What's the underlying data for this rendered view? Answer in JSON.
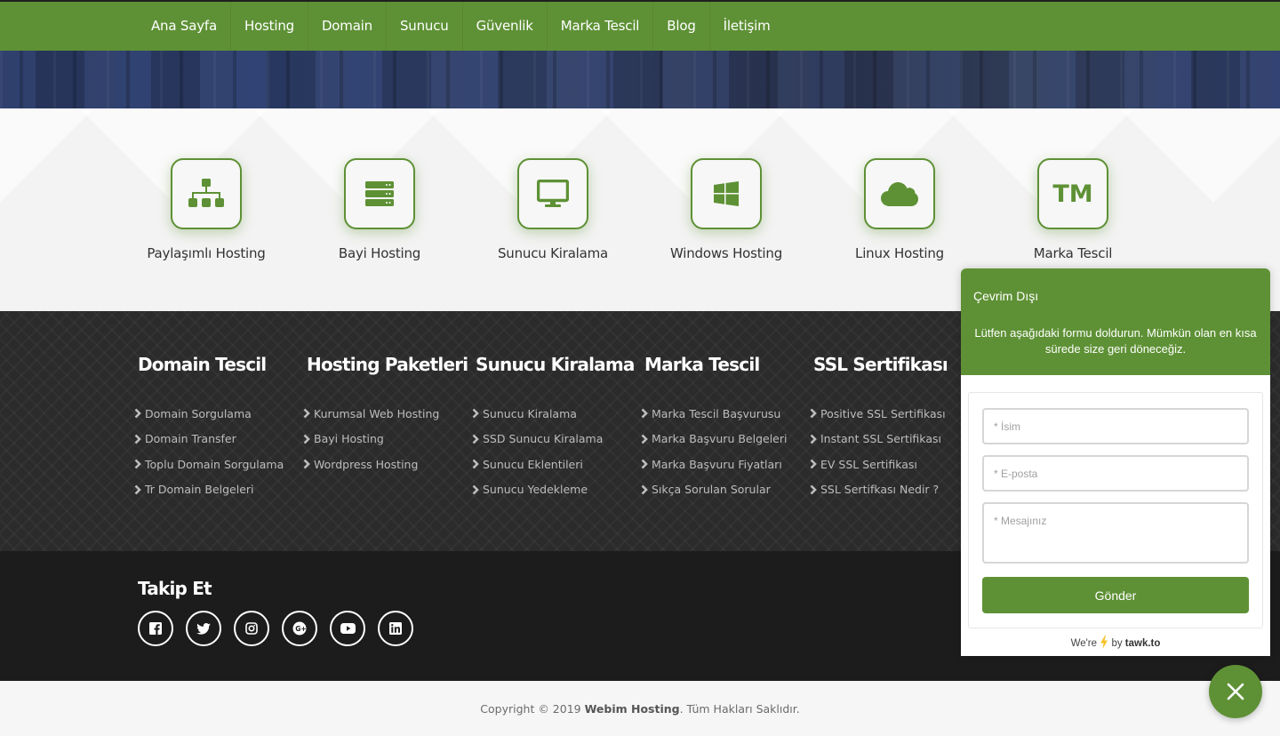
{
  "nav": {
    "items": [
      {
        "label": "Ana Sayfa"
      },
      {
        "label": "Hosting"
      },
      {
        "label": "Domain"
      },
      {
        "label": "Sunucu"
      },
      {
        "label": "Güvenlik"
      },
      {
        "label": "Marka Tescil"
      },
      {
        "label": "Blog"
      },
      {
        "label": "İletişim"
      }
    ]
  },
  "colors": {
    "brand_green": "#5e9135",
    "footer_dark": "#2b2b2b",
    "social_bg": "#1c1c1c"
  },
  "services": [
    {
      "label": "Paylaşımlı Hosting",
      "icon": "sitemap-icon"
    },
    {
      "label": "Bayi Hosting",
      "icon": "server-icon"
    },
    {
      "label": "Sunucu Kiralama",
      "icon": "desktop-icon"
    },
    {
      "label": "Windows Hosting",
      "icon": "windows-icon"
    },
    {
      "label": "Linux Hosting",
      "icon": "cloud-icon"
    },
    {
      "label": "Marka Tescil",
      "icon": "trademark-icon",
      "glyph": "TM"
    }
  ],
  "footer_columns": [
    {
      "title": "Domain Tescil",
      "links": [
        "Domain Sorgulama",
        "Domain Transfer",
        "Toplu Domain Sorgulama",
        "Tr Domain Belgeleri"
      ]
    },
    {
      "title": "Hosting Paketleri",
      "links": [
        "Kurumsal Web Hosting",
        "Bayi Hosting",
        "Wordpress Hosting"
      ]
    },
    {
      "title": "Sunucu Kiralama",
      "links": [
        "Sunucu Kiralama",
        "SSD Sunucu Kiralama",
        "Sunucu Eklentileri",
        "Sunucu Yedekleme"
      ]
    },
    {
      "title": "Marka Tescil",
      "links": [
        "Marka Tescil Başvurusu",
        "Marka Başvuru Belgeleri",
        "Marka Başvuru Fiyatları",
        "Sıkça Sorulan Sorular"
      ]
    },
    {
      "title": "SSL Sertifikası",
      "links": [
        "Positive SSL Sertifikası",
        "Instant SSL Sertifikası",
        "EV SSL Sertifikası",
        "SSL Sertifkası Nedir ?"
      ]
    }
  ],
  "social": {
    "title": "Takip Et",
    "items": [
      "facebook",
      "twitter",
      "instagram",
      "google-plus",
      "youtube",
      "linkedin"
    ]
  },
  "copyright": {
    "prefix": "Copyright © 2019 ",
    "brand": "Webim Hosting",
    "suffix": ". Tüm Hakları Saklıdır."
  },
  "chat": {
    "status": "Çevrim Dışı",
    "message": "Lütfen aşağıdaki formu doldurun. Mümkün olan en kısa sürede size geri döneceğiz.",
    "name_placeholder": "* İsim",
    "email_placeholder": "* E-posta",
    "message_placeholder": "* Mesajınız",
    "name_value": "",
    "email_value": "",
    "message_value": "",
    "submit_label": "Gönder",
    "brand_prefix": "We're",
    "brand_by": "by",
    "brand_name": "tawk.to"
  }
}
